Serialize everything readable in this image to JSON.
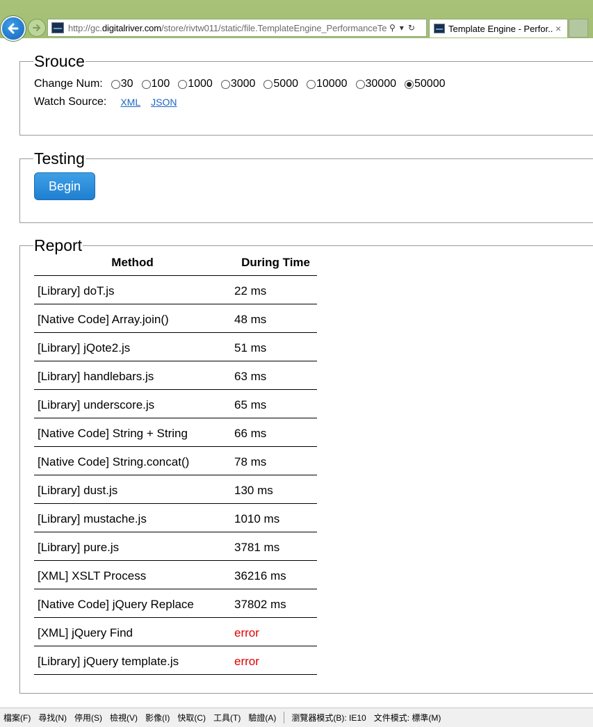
{
  "browser": {
    "address_prefix": "http://gc.",
    "address_domain": "digitalriver.com",
    "address_rest": "/store/rivtw011/static/file.TemplateEngine_PerformanceTe",
    "tab_title": "Template Engine - Perfor...",
    "tab_close": "×",
    "search_glyph": "⚲",
    "dropdown_glyph": "▾",
    "refresh_glyph": "↻"
  },
  "source": {
    "legend": "Srouce",
    "change_num_label": "Change Num:",
    "options": [
      {
        "label": "30",
        "checked": false
      },
      {
        "label": "100",
        "checked": false
      },
      {
        "label": "1000",
        "checked": false
      },
      {
        "label": "3000",
        "checked": false
      },
      {
        "label": "5000",
        "checked": false
      },
      {
        "label": "10000",
        "checked": false
      },
      {
        "label": "30000",
        "checked": false
      },
      {
        "label": "50000",
        "checked": true
      }
    ],
    "watch_source_label": "Watch Source:",
    "links": {
      "xml": "XML",
      "json": "JSON"
    }
  },
  "testing": {
    "legend": "Testing",
    "begin_label": "Begin"
  },
  "report": {
    "legend": "Report",
    "headers": {
      "method": "Method",
      "time": "During Time"
    },
    "rows": [
      {
        "method": "[Library] doT.js",
        "time": "22 ms",
        "error": false
      },
      {
        "method": "[Native Code] Array.join()",
        "time": "48 ms",
        "error": false
      },
      {
        "method": "[Library] jQote2.js",
        "time": "51 ms",
        "error": false
      },
      {
        "method": "[Library] handlebars.js",
        "time": "63 ms",
        "error": false
      },
      {
        "method": "[Library] underscore.js",
        "time": "65 ms",
        "error": false
      },
      {
        "method": "[Native Code] String + String",
        "time": "66 ms",
        "error": false
      },
      {
        "method": "[Native Code] String.concat()",
        "time": "78 ms",
        "error": false
      },
      {
        "method": "[Library] dust.js",
        "time": "130 ms",
        "error": false
      },
      {
        "method": "[Library] mustache.js",
        "time": "1010 ms",
        "error": false
      },
      {
        "method": "[Library] pure.js",
        "time": "3781 ms",
        "error": false
      },
      {
        "method": "[XML] XSLT Process",
        "time": "36216 ms",
        "error": false
      },
      {
        "method": "[Native Code] jQuery Replace",
        "time": "37802 ms",
        "error": false
      },
      {
        "method": "[XML] jQuery Find",
        "time": "error",
        "error": true
      },
      {
        "method": "[Library] jQuery template.js",
        "time": "error",
        "error": true
      }
    ]
  },
  "statusbar": {
    "menus": [
      "檔案(F)",
      "尋找(N)",
      "停用(S)",
      "檢視(V)",
      "影像(I)",
      "快取(C)",
      "工具(T)",
      "驗證(A)"
    ],
    "browser_mode": "瀏覽器模式(B): IE10",
    "document_mode": "文件模式: 標準(M)"
  },
  "colors": {
    "chrome": "#a3be74",
    "link": "#1a66c2",
    "button": "#2b8ddc",
    "error": "#e00000"
  }
}
